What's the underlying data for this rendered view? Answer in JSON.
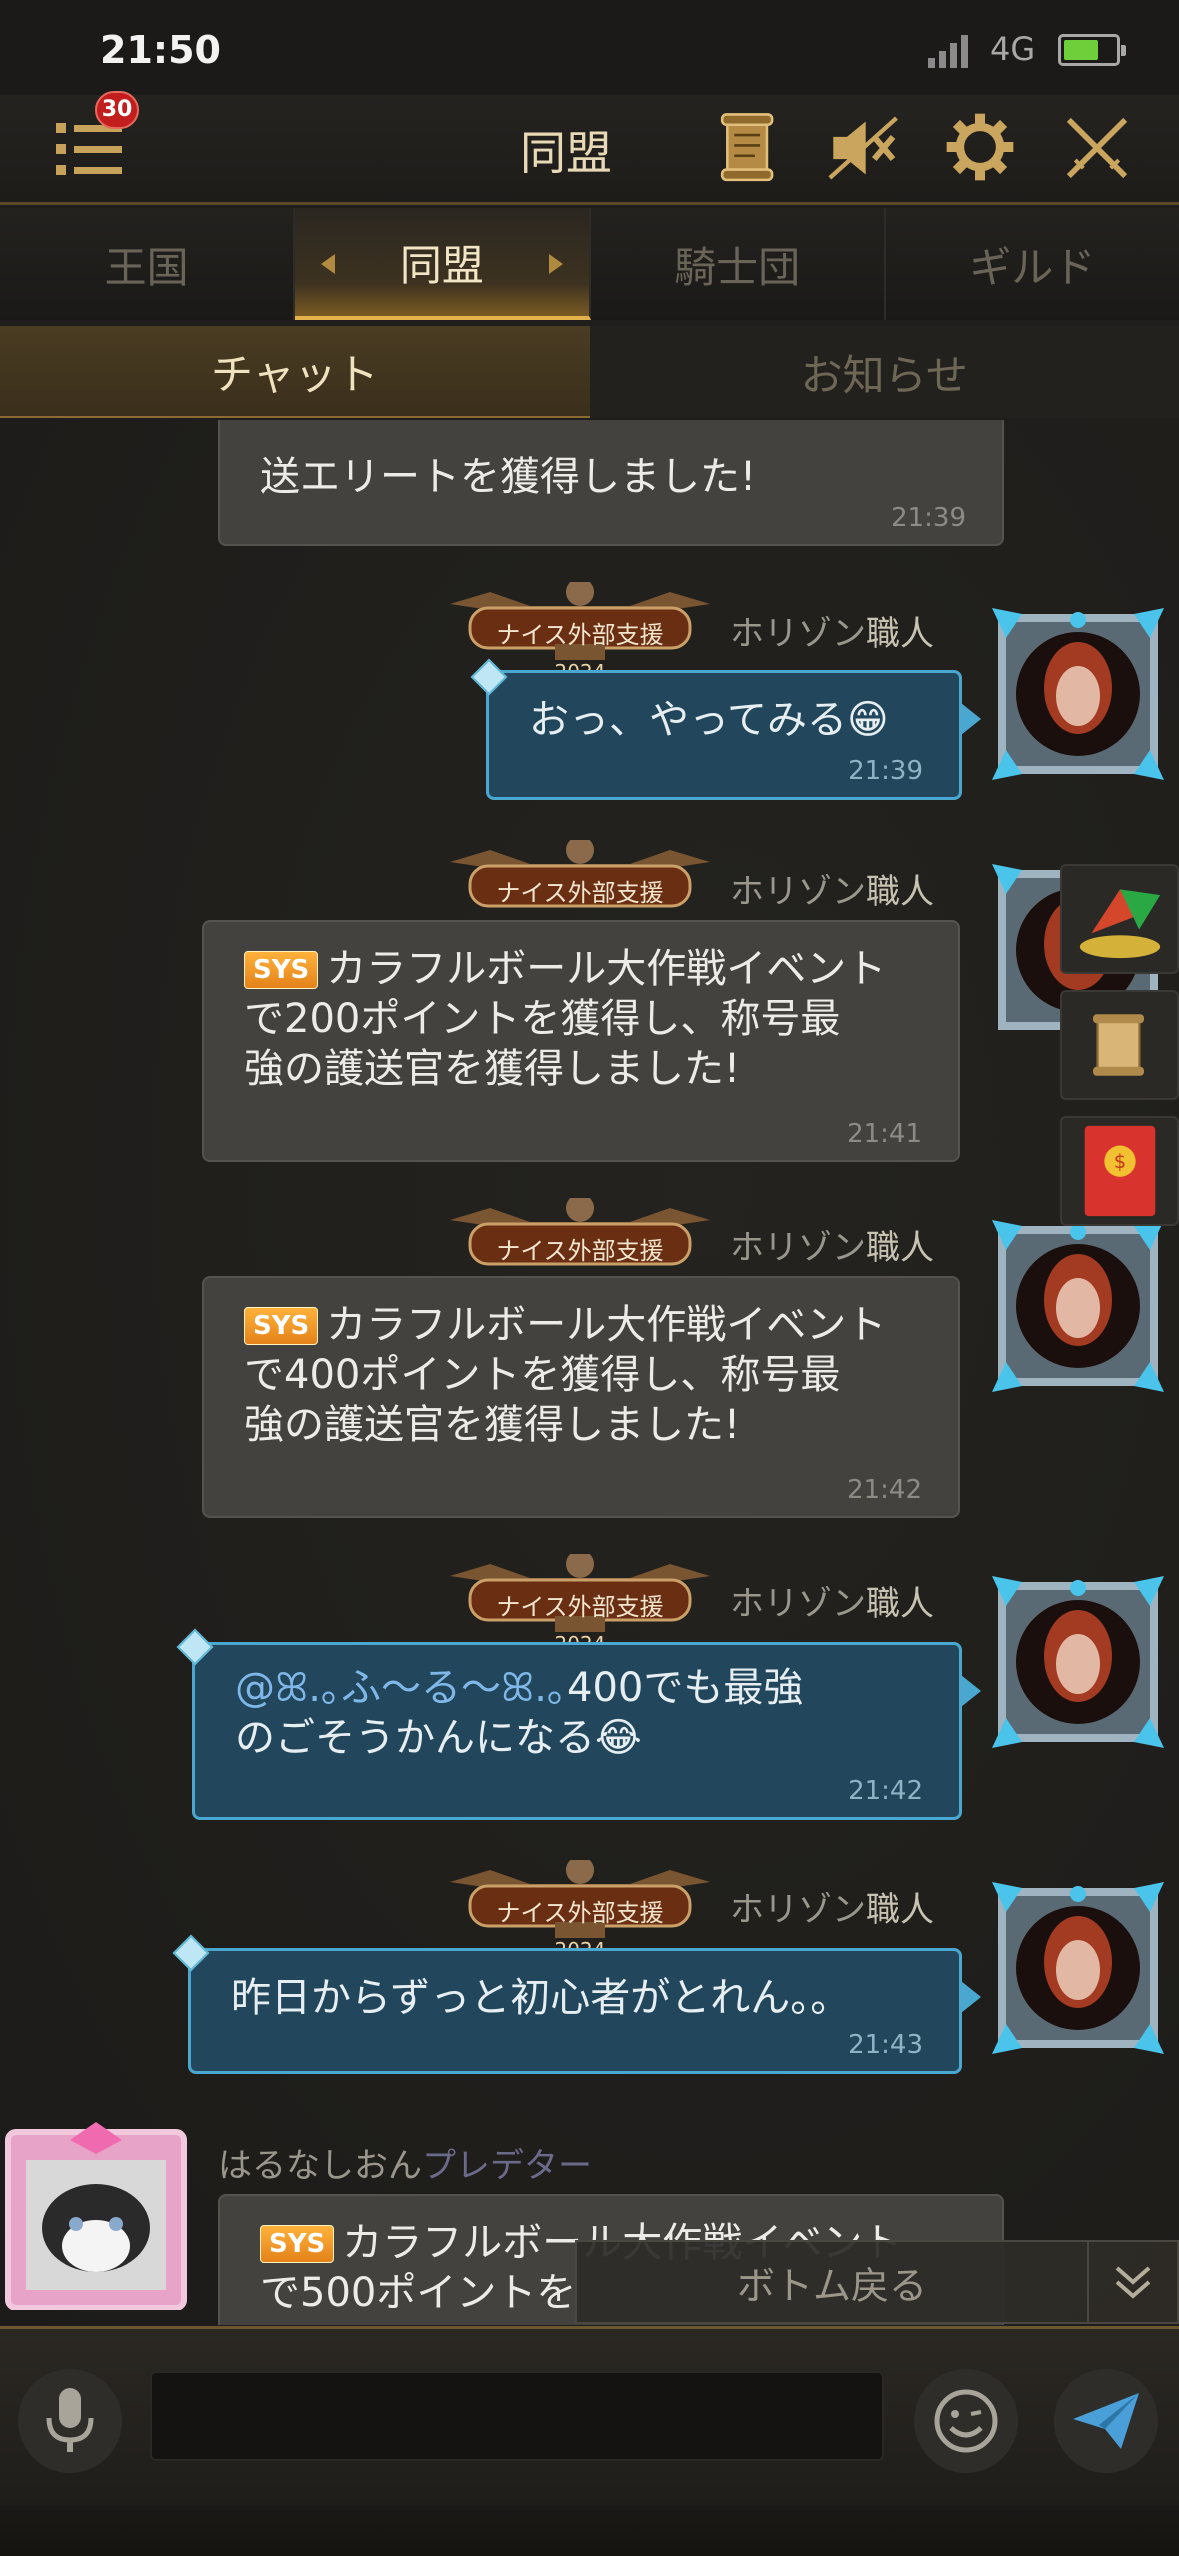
{
  "status_bar": {
    "time": "21:50",
    "network": "4G"
  },
  "header": {
    "title": "同盟",
    "notification_count": "30"
  },
  "tabs": [
    {
      "label": "王国"
    },
    {
      "label": "同盟"
    },
    {
      "label": "騎士団"
    },
    {
      "label": "ギルド"
    }
  ],
  "subtabs": [
    {
      "label": "チャット"
    },
    {
      "label": "お知らせ"
    }
  ],
  "messages": [
    {
      "text": "送エリートを獲得しました!",
      "time": "21:39"
    },
    {
      "sender": "ホリゾン",
      "role": "職人",
      "badge": "ナイス外部支援",
      "badge_year": "2024",
      "text": "おっ、やってみる😁",
      "time": "21:39"
    },
    {
      "sender": "ホリゾン",
      "role": "職人",
      "badge": "ナイス外部支援",
      "sys_tag": "SYS",
      "line1": "カラフルボール大作戦イベント",
      "line2": "で200ポイントを獲得し、称号最",
      "line3": "強の護送官を獲得しました!",
      "time": "21:41"
    },
    {
      "sender": "ホリゾン",
      "role": "職人",
      "badge": "ナイス外部支援",
      "sys_tag": "SYS",
      "line1": "カラフルボール大作戦イベント",
      "line2": "で400ポイントを獲得し、称号最",
      "line3": "強の護送官を獲得しました!",
      "time": "21:42"
    },
    {
      "sender": "ホリゾン",
      "role": "職人",
      "badge": "ナイス外部支援",
      "badge_year": "2024",
      "mention": "@ꕤ.｡ふ～る～ꕤ.｡",
      "line1": "400でも最強",
      "line2": "のごそうかんになる😂",
      "time": "21:42"
    },
    {
      "sender": "ホリゾン",
      "role": "職人",
      "badge": "ナイス外部支援",
      "badge_year": "2024",
      "text": "昨日からずっと初心者がとれん。。",
      "time": "21:43"
    },
    {
      "sender": "はるなしおん",
      "role": "プレデター",
      "sys_tag": "SYS",
      "line1": "カラフルボール大作戦イベント",
      "line2": "で500ポイントを"
    }
  ],
  "back_to_bottom": "ボトム戻る",
  "input": {
    "placeholder": ""
  },
  "colors": {
    "accent_gold": "#e3b24a",
    "my_bubble": "#22475c",
    "my_border": "#4aa8d0",
    "sys_bubble": "#43423e",
    "sys_tag": "#f29a2a",
    "badge_red": "#c21e1e"
  }
}
